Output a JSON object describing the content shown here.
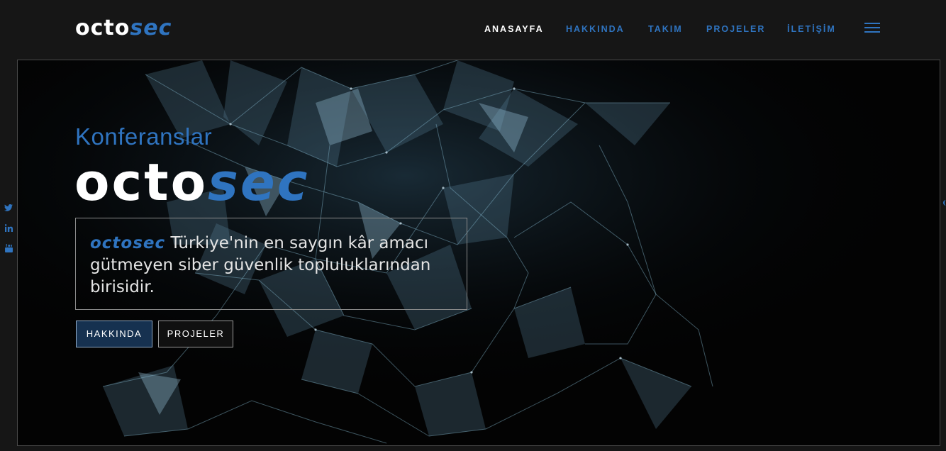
{
  "brand": {
    "part1": "octo",
    "part2": "sec"
  },
  "nav": {
    "items": [
      {
        "label": "ANASAYFA",
        "active": true
      },
      {
        "label": "HAKKINDA",
        "active": false
      },
      {
        "label": "TAKIM",
        "active": false
      },
      {
        "label": "PROJELER",
        "active": false
      },
      {
        "label": "İLETİŞİM",
        "active": false
      }
    ]
  },
  "social": [
    "twitter-icon",
    "linkedin-icon",
    "youtube-icon"
  ],
  "hero": {
    "eyebrow": "Konferanslar",
    "logo": {
      "part1": "octo",
      "part2": "sec"
    },
    "description": {
      "brand": "octosec",
      "text": " Türkiye'nin en saygın kâr amacı gütmeyen siber güvenlik topluluklarından birisidir."
    },
    "buttons": {
      "primary": "HAKKINDA",
      "secondary": "PROJELER"
    }
  },
  "colors": {
    "accent": "#2f74c0",
    "background": "#161616",
    "hero": "#030303"
  }
}
